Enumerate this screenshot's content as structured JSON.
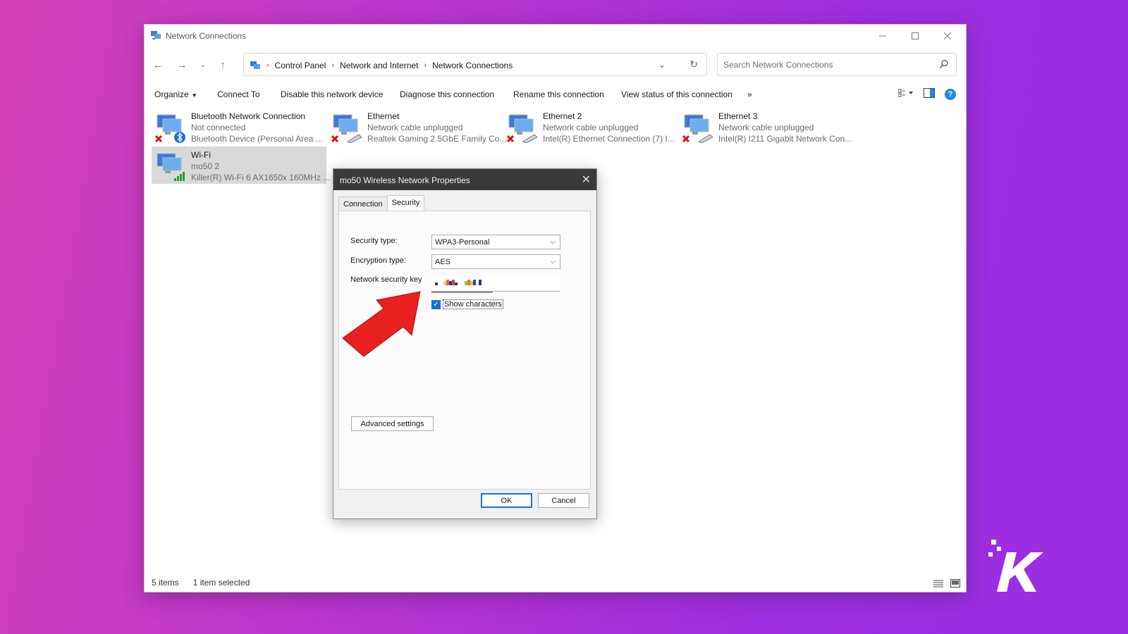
{
  "window": {
    "title": "Network Connections"
  },
  "address": {
    "breadcrumbs": [
      "Control Panel",
      "Network and Internet",
      "Network Connections"
    ],
    "search_placeholder": "Search Network Connections"
  },
  "toolbar": {
    "organize": "Organize",
    "connect_to": "Connect To",
    "disable": "Disable this network device",
    "diagnose": "Diagnose this connection",
    "rename": "Rename this connection",
    "view_status": "View status of this connection",
    "more": "»"
  },
  "connections": [
    {
      "name": "Bluetooth Network Connection",
      "status": "Not connected",
      "device": "Bluetooth Device (Personal Area ...",
      "icon": "bluetooth-network-icon"
    },
    {
      "name": "Ethernet",
      "status": "Network cable unplugged",
      "device": "Realtek Gaming 2.5GbE Family Co...",
      "icon": "ethernet-icon"
    },
    {
      "name": "Ethernet 2",
      "status": "Network cable unplugged",
      "device": "Intel(R) Ethernet Connection (7) I...",
      "icon": "ethernet-icon"
    },
    {
      "name": "Ethernet 3",
      "status": "Network cable unplugged",
      "device": "Intel(R) I211 Gigabit Network Con...",
      "icon": "ethernet-icon"
    },
    {
      "name": "Wi-Fi",
      "status": "mo50 2",
      "device": "Killer(R) Wi-Fi 6 AX1650x 160MHz ...",
      "icon": "wifi-icon",
      "selected": true
    }
  ],
  "status_bar": {
    "items": "5 items",
    "selected": "1 item selected"
  },
  "dialog": {
    "title": "mo50 Wireless Network Properties",
    "tabs": [
      "Connection",
      "Security"
    ],
    "active_tab": "Security",
    "security_type_label": "Security type:",
    "security_type_value": "WPA3-Personal",
    "encryption_type_label": "Encryption type:",
    "encryption_type_value": "AES",
    "network_key_label": "Network security key",
    "show_characters_label": "Show characters",
    "show_characters_checked": true,
    "advanced_button": "Advanced settings",
    "ok_button": "OK",
    "cancel_button": "Cancel"
  },
  "colors": {
    "background_left": "#d43fb8",
    "background_right": "#9a2de2",
    "accent_blue": "#1f6fd0",
    "arrow_red": "#e8201f"
  }
}
